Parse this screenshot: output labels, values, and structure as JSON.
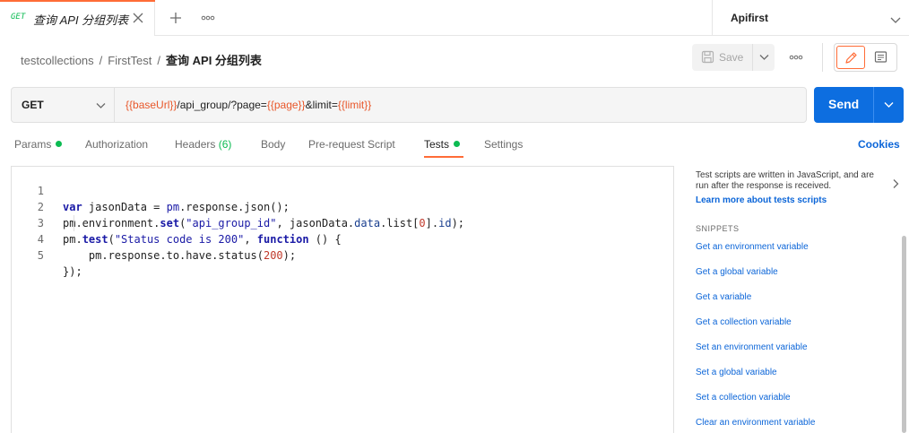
{
  "tab": {
    "method": "GET",
    "title": "查询 API 分组列表"
  },
  "environment": {
    "name": "Apifirst"
  },
  "breadcrumb": {
    "collection": "testcollections",
    "folder": "FirstTest",
    "request": "查询 API 分组列表"
  },
  "toolbar": {
    "save_label": "Save"
  },
  "request": {
    "method": "GET",
    "url": {
      "v1": "{{baseUrl}}",
      "t1": "/api_group/?page=",
      "v2": "{{page}}",
      "t2": "&limit=",
      "v3": "{{limit}}"
    },
    "send_label": "Send"
  },
  "subtabs": {
    "params": "Params",
    "authorization": "Authorization",
    "headers": "Headers",
    "headers_count": "(6)",
    "body": "Body",
    "prerequest": "Pre-request Script",
    "tests": "Tests",
    "settings": "Settings",
    "cookies": "Cookies"
  },
  "editor": {
    "line_numbers": [
      "1",
      "2",
      "3",
      "4",
      "5"
    ],
    "l1": {
      "kw": "var",
      "a": " jasonData = ",
      "b": "pm",
      "c": ".response.json();"
    },
    "l2": {
      "a": "pm.environment.",
      "fn": "set",
      "b": "(",
      "str": "\"api_group_id\"",
      "c": ", jasonData.",
      "pr1": "data",
      "d": ".list[",
      "n": "0",
      "e": "].",
      "pr2": "id",
      "f": ");"
    },
    "l3": {
      "a": "pm.",
      "fn": "test",
      "b": "(",
      "str": "\"Status code is 200\"",
      "c": ", ",
      "kw": "function",
      "d": " () {"
    },
    "l4": {
      "a": "    pm.response.to.have.status(",
      "n": "200",
      "b": ");"
    },
    "l5": {
      "a": "});"
    }
  },
  "panel": {
    "description": "Test scripts are written in JavaScript, and are run after the response is received.",
    "learn_more": "Learn more about tests scripts",
    "snippets_heading": "SNIPPETS",
    "snippets": [
      "Get an environment variable",
      "Get a global variable",
      "Get a variable",
      "Get a collection variable",
      "Set an environment variable",
      "Set a global variable",
      "Set a collection variable",
      "Clear an environment variable"
    ]
  },
  "icons": [
    "close-icon",
    "plus-icon",
    "more-icon",
    "chevron-down-icon",
    "save-icon",
    "pencil-icon",
    "document-icon",
    "chevron-right-icon"
  ],
  "colors": {
    "accent": "#ff6c37",
    "primary": "#0d6ee0",
    "success": "#0cbb52",
    "variable": "#e8572a"
  }
}
